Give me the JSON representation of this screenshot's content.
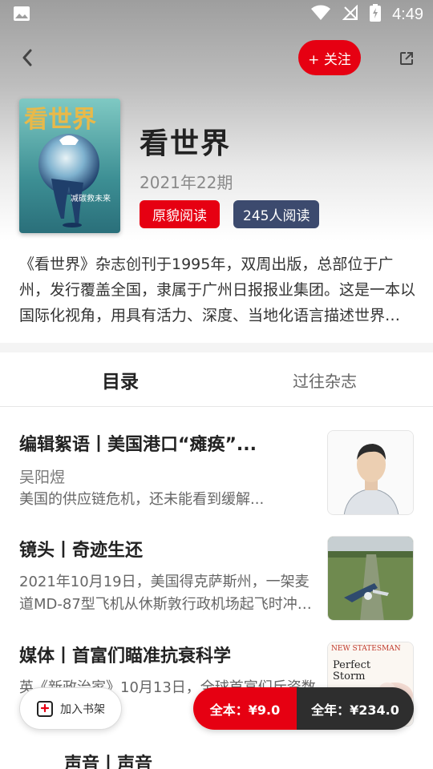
{
  "status_bar": {
    "time": "4:49",
    "icons": [
      "image-icon",
      "wifi-icon",
      "no-signal-icon",
      "battery-charging-icon"
    ]
  },
  "header": {
    "back_icon": "chevron-left-icon",
    "follow_label": "+ 关注",
    "share_icon": "share-external-icon"
  },
  "magazine": {
    "title": "看世界",
    "issue": "2021年22期",
    "cover_title_text": "看世界",
    "cover_caption": "减碳救未来",
    "read_mode_label": "原貌阅读",
    "readers_label": "245人阅读",
    "description": "《看世界》杂志创刊于1995年，双周出版，总部位于广州，发行覆盖全国，隶属于广州日报报业集团。这是一本以国际化视角，用具有活力、深度、当地化语言描述世界的杂志。"
  },
  "tabs": [
    {
      "label": "目录",
      "active": true
    },
    {
      "label": "过往杂志",
      "active": false
    }
  ],
  "articles": [
    {
      "title": "编辑絮语丨美国港口“瘫痪”...",
      "author": "吴阳煜",
      "summary": " 美国的供应链危机，还未能看到缓解...",
      "thumb": "portrait-illustration"
    },
    {
      "title": "镜头丨奇迹生还",
      "body": "2021年10月19日，美国得克萨斯州，一架麦道MD-87型飞机从休斯敦行政机场起飞时冲出跑道",
      "thumb": "aerial-plane-crash-photo"
    },
    {
      "title": "媒体丨首富们瞄准抗衰科学",
      "body": "英《新政治家》10月13日，全球首富们斥资数十亿万年的历史",
      "thumb_text_1": "NEW STATESMAN",
      "thumb_text_2": "Perfect",
      "thumb_text_3": "Storm"
    }
  ],
  "partial_article_title": "声音丨声音",
  "bottom_bar": {
    "bookshelf_label": "加入书架",
    "bookshelf_icon": "bookshelf-add-icon",
    "buy_single_label": "全本：¥9.0",
    "buy_year_label": "全年：¥234.0"
  },
  "colors": {
    "accent_red": "#e60012",
    "dark_tag": "#3c4a6e",
    "dark_button": "#2e2e2e"
  }
}
